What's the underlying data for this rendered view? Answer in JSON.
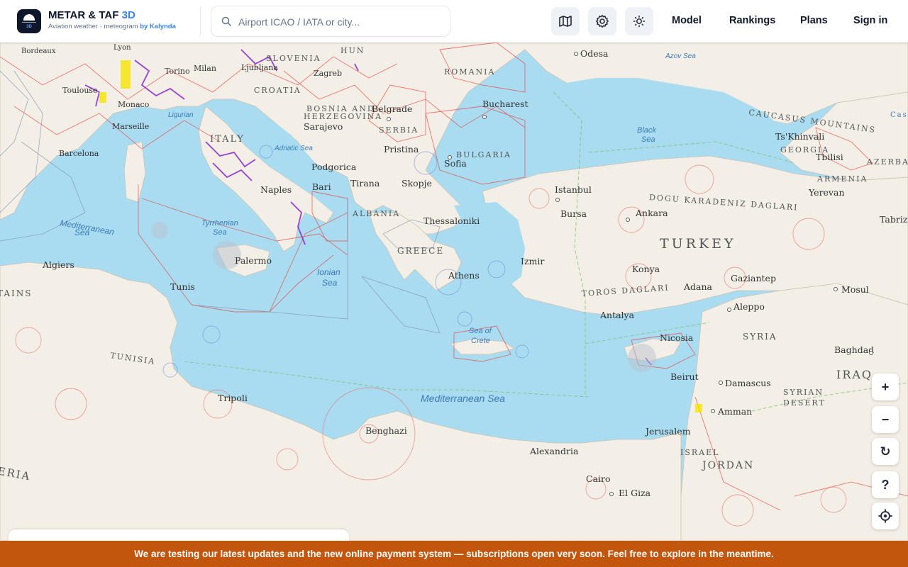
{
  "header": {
    "logo_tag": "3D",
    "title": "METAR & TAF",
    "title_accent": "3D",
    "subtitle": "Aviation weather · meteogram",
    "subtitle_by": "by Kalynda",
    "search_placeholder": "Airport ICAO / IATA or city...",
    "icons": [
      "map-icon",
      "settings-gear-icon",
      "theme-sun-icon"
    ],
    "nav": [
      "Model",
      "Rankings",
      "Plans",
      "Sign in"
    ]
  },
  "map": {
    "cities": [
      "Lyon",
      "Milan",
      "Ljubljana",
      "Zagreb",
      "Torino",
      "Monaco",
      "Marseille",
      "Barcelona",
      "Toulouse",
      "Bordeaux",
      "Belgrade",
      "Bucharest",
      "Odesa",
      "Sarajevo",
      "Podgorica",
      "Pristina",
      "Sofia",
      "Tirana",
      "Skopje",
      "Istanbul",
      "Bursa",
      "Thessaloniki",
      "Naples",
      "Bari",
      "Palermo",
      "Tunis",
      "Algiers",
      "Athens",
      "Izmir",
      "Ankara",
      "Konya",
      "Adana",
      "Antalya",
      "Gaziantep",
      "Mosul",
      "Aleppo",
      "Nicosia",
      "Beirut",
      "Damascus",
      "Baghdad",
      "Amman",
      "Jerusalem",
      "Tripoli",
      "Benghazi",
      "Alexandria",
      "Cairo",
      "El Giza",
      "Tbilisi",
      "Yerevan",
      "Tabriz",
      "Ts'Khinvali"
    ],
    "countries": [
      "SLOVENIA",
      "HUN",
      "ROMANIA",
      "CROATIA",
      "BOSNIA AND",
      "HERZEGOVINA",
      "SERBIA",
      "BULGARIA",
      "ITALY",
      "ALBANIA",
      "GREECE",
      "TURKEY",
      "SYRIA",
      "IRAQ",
      "ISRAEL",
      "JORDAN",
      "TUNISIA",
      "GEORGIA",
      "ARMENIA",
      "AZERBAIJ",
      "ERIA",
      "TAINS"
    ],
    "water": [
      "Black",
      "Sea",
      "Azov Sea",
      "Adriatic Sea",
      "Tyrrhenian",
      "Sea",
      "Ionian",
      "Sea",
      "Mediterranean",
      "Sea",
      "Sea of",
      "Crete",
      "Mediterranean Sea",
      "Ligurian"
    ],
    "regions": [
      "CAUCASUS MOUNTAINS",
      "DOGU KARADENIZ DAGLARI",
      "TOROS DAGLARI",
      "SYRIAN",
      "DESERT",
      "Casp"
    ]
  },
  "controls": {
    "zoom_in": "+",
    "zoom_out": "−",
    "reset": "↻",
    "help": "?",
    "locate_icon": "crosshair-icon"
  },
  "banner": {
    "text": "We are testing our latest updates and the new online payment system — subscriptions open very soon. Feel free to explore in the meantime."
  },
  "colors": {
    "accent": "#3b82f6",
    "banner": "#c2560c",
    "sea": "#9fd6ee",
    "land": "#f4f1ea"
  }
}
